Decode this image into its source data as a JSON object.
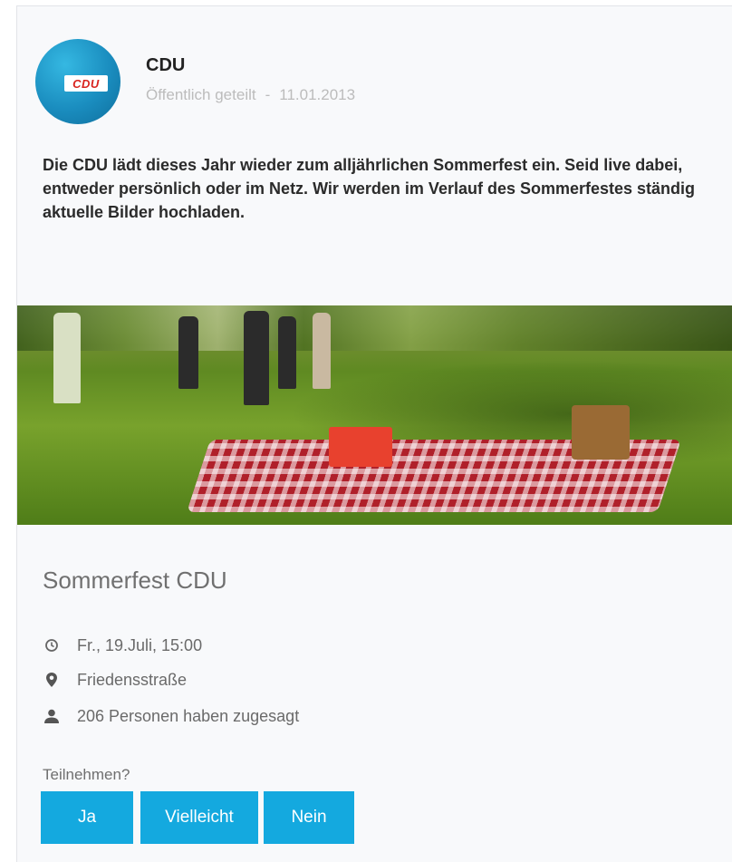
{
  "post": {
    "author": "CDU",
    "visibility": "Öffentlich geteilt",
    "separator": "-",
    "date": "11.01.2013",
    "text": "Die CDU lädt dieses Jahr wieder zum alljährlichen Sommerfest ein. Seid live dabei, entweder persönlich oder im Netz. Wir werden im Verlauf des Sommerfestes ständig aktuelle Bilder hochladen.",
    "avatar_logo_text": "CDU"
  },
  "event": {
    "title": "Sommerfest CDU",
    "datetime": "Fr., 19.Juli, 15:00",
    "location": "Friedensstraße",
    "attendees": "206 Personen haben zugesagt"
  },
  "rsvp": {
    "question": "Teilnehmen?",
    "yes_label": "Ja",
    "maybe_label": "Vielleicht",
    "no_label": "Nein"
  },
  "icons": {
    "time": "clock-icon",
    "location": "location-pin-icon",
    "attendees": "person-icon"
  },
  "colors": {
    "accent": "#14a9df",
    "avatar_blue": "#1a8dbf",
    "logo_red": "#d8231e"
  }
}
